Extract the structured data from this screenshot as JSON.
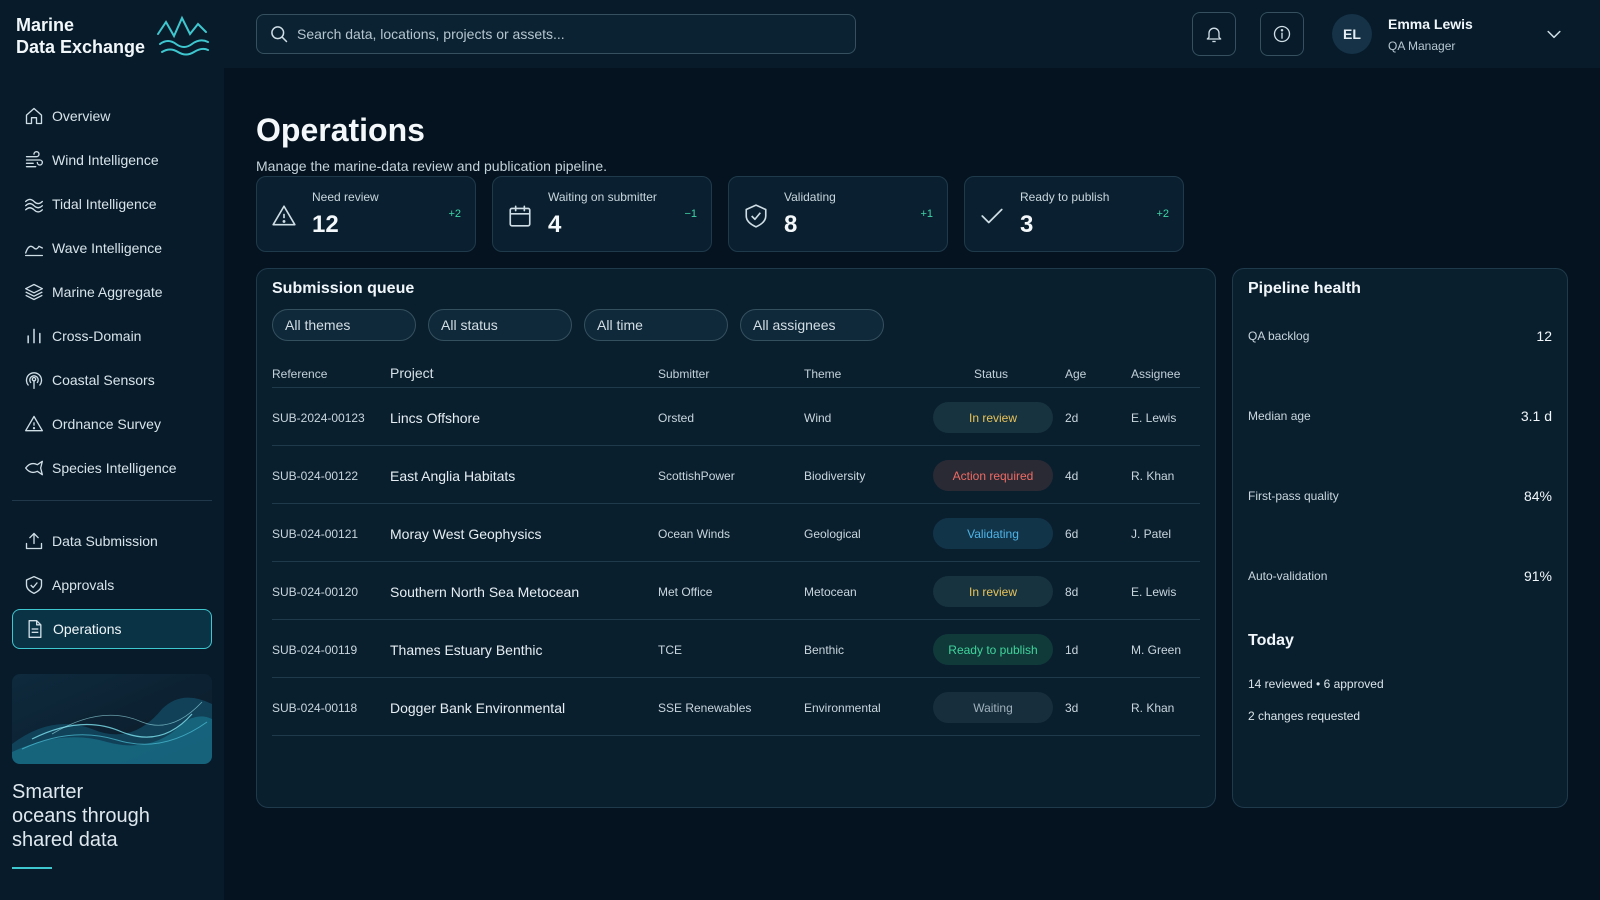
{
  "brand": {
    "line1": "Marine",
    "line2": "Data Exchange"
  },
  "nav": {
    "primary": [
      {
        "label": "Overview",
        "icon": "home-icon"
      },
      {
        "label": "Wind Intelligence",
        "icon": "wind-icon"
      },
      {
        "label": "Tidal Intelligence",
        "icon": "tide-icon"
      },
      {
        "label": "Wave Intelligence",
        "icon": "wave-icon"
      },
      {
        "label": "Marine Aggregate",
        "icon": "layers-icon"
      },
      {
        "label": "Cross-Domain",
        "icon": "bar-chart-icon"
      },
      {
        "label": "Coastal Sensors",
        "icon": "antenna-icon"
      },
      {
        "label": "Ordnance Survey",
        "icon": "warning-icon"
      },
      {
        "label": "Species Intelligence",
        "icon": "fish-icon"
      }
    ],
    "secondary": [
      {
        "label": "Data Submission",
        "icon": "upload-icon"
      },
      {
        "label": "Approvals",
        "icon": "shield-check-icon"
      },
      {
        "label": "Operations",
        "icon": "document-icon",
        "active": true
      }
    ]
  },
  "tagline": {
    "line1": "Smarter",
    "line2": "oceans through",
    "line3": "shared data"
  },
  "search": {
    "placeholder": "Search data, locations, projects or assets..."
  },
  "user": {
    "initials": "EL",
    "name": "Emma Lewis",
    "role": "QA Manager"
  },
  "page": {
    "title": "Operations",
    "subtitle": "Manage the marine-data review and publication pipeline."
  },
  "stats": [
    {
      "label": "Need review",
      "value": "12",
      "delta": "+2",
      "icon": "warning-icon"
    },
    {
      "label": "Waiting on submitter",
      "value": "4",
      "delta": "−1",
      "icon": "calendar-icon"
    },
    {
      "label": "Validating",
      "value": "8",
      "delta": "+1",
      "icon": "shield-check-icon"
    },
    {
      "label": "Ready to publish",
      "value": "3",
      "delta": "+2",
      "icon": "check-icon"
    }
  ],
  "queue": {
    "title": "Submission queue",
    "filters": [
      "All themes",
      "All status",
      "All time",
      "All assignees"
    ],
    "columns": {
      "reference": "Reference",
      "project": "Project",
      "submitter": "Submitter",
      "theme": "Theme",
      "status": "Status",
      "age": "Age",
      "assignee": "Assignee"
    },
    "rows": [
      {
        "reference": "SUB-2024-00123",
        "project": "Lincs Offshore",
        "submitter": "Orsted",
        "theme": "Wind",
        "status": "In review",
        "age": "2d",
        "assignee": "E. Lewis"
      },
      {
        "reference": "SUB-024-00122",
        "project": "East Anglia Habitats",
        "submitter": "ScottishPower",
        "theme": "Biodiversity",
        "status": "Action required",
        "age": "4d",
        "assignee": "R. Khan"
      },
      {
        "reference": "SUB-024-00121",
        "project": "Moray West Geophysics",
        "submitter": "Ocean Winds",
        "theme": "Geological",
        "status": "Validating",
        "age": "6d",
        "assignee": "J. Patel"
      },
      {
        "reference": "SUB-024-00120",
        "project": "Southern North Sea Metocean",
        "submitter": "Met Office",
        "theme": "Metocean",
        "status": "In review",
        "age": "8d",
        "assignee": "E. Lewis"
      },
      {
        "reference": "SUB-024-00119",
        "project": "Thames Estuary Benthic",
        "submitter": "TCE",
        "theme": "Benthic",
        "status": "Ready to publish",
        "age": "1d",
        "assignee": "M. Green"
      },
      {
        "reference": "SUB-024-00118",
        "project": "Dogger Bank Environmental",
        "submitter": "SSE Renewables",
        "theme": "Environmental",
        "status": "Waiting",
        "age": "3d",
        "assignee": "R. Khan"
      }
    ]
  },
  "status_colors": {
    "In review": {
      "fg": "#e8c35a",
      "bg": "#17333f"
    },
    "Action required": {
      "fg": "#ef6b63",
      "bg": "#2a2a35"
    },
    "Validating": {
      "fg": "#4db3e6",
      "bg": "#123449"
    },
    "Ready to publish": {
      "fg": "#3fd49a",
      "bg": "#103a3a"
    },
    "Waiting": {
      "fg": "#9fb0ba",
      "bg": "#172f3d"
    }
  },
  "health": {
    "title": "Pipeline health",
    "metrics": [
      {
        "label": "QA backlog",
        "value": "12"
      },
      {
        "label": "Median age",
        "value": "3.1 d"
      },
      {
        "label": "First-pass quality",
        "value": "84%"
      },
      {
        "label": "Auto-validation",
        "value": "91%"
      }
    ],
    "today_title": "Today",
    "today_lines": [
      "14 reviewed • 6 approved",
      "2 changes requested"
    ]
  },
  "accent": "#3fc7cf"
}
